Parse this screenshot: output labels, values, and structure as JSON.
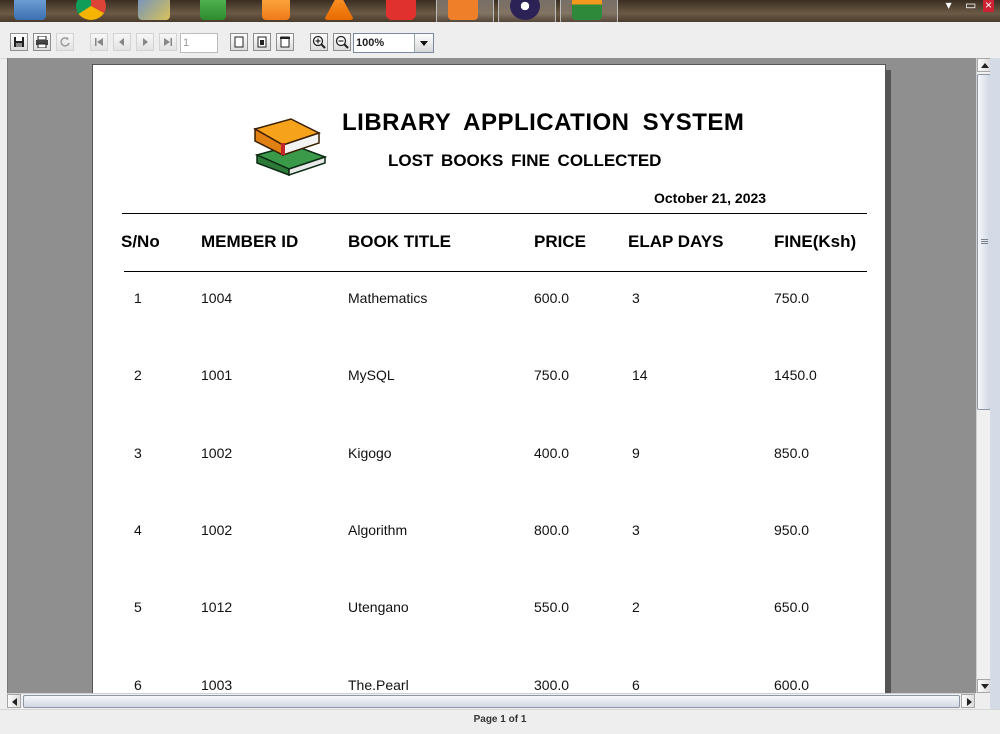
{
  "toolbar": {
    "page_number": "1",
    "zoom": "100%"
  },
  "report": {
    "title": "LIBRARY  APPLICATION  SYSTEM",
    "subtitle": "LOST BOOKS  FINE COLLECTED",
    "date": "October 21, 2023",
    "columns": [
      "S/No",
      "MEMBER ID",
      "BOOK  TITLE",
      "PRICE",
      "ELAP DAYS",
      "FINE(Ksh)"
    ],
    "rows": [
      [
        "1",
        "1004",
        "Mathematics",
        "600.0",
        "3",
        "750.0"
      ],
      [
        "2",
        "1001",
        "MySQL",
        "750.0",
        "14",
        "1450.0"
      ],
      [
        "3",
        "1002",
        "Kigogo",
        "400.0",
        "9",
        "850.0"
      ],
      [
        "4",
        "1002",
        "Algorithm",
        "800.0",
        "3",
        "950.0"
      ],
      [
        "5",
        "1012",
        "Utengano",
        "550.0",
        "2",
        "650.0"
      ],
      [
        "6",
        "1003",
        "The.Pearl",
        "300.0",
        "6",
        "600.0"
      ]
    ]
  },
  "status": {
    "page_indicator": "Page 1 of 1"
  },
  "taskbar_icons": [
    "file-manager-icon",
    "chrome-icon",
    "network-icon",
    "spreadsheet-icon",
    "media-player-icon",
    "vlc-icon",
    "vivaldi-icon",
    "xampp-icon",
    "eclipse-icon",
    "library-app-icon"
  ]
}
